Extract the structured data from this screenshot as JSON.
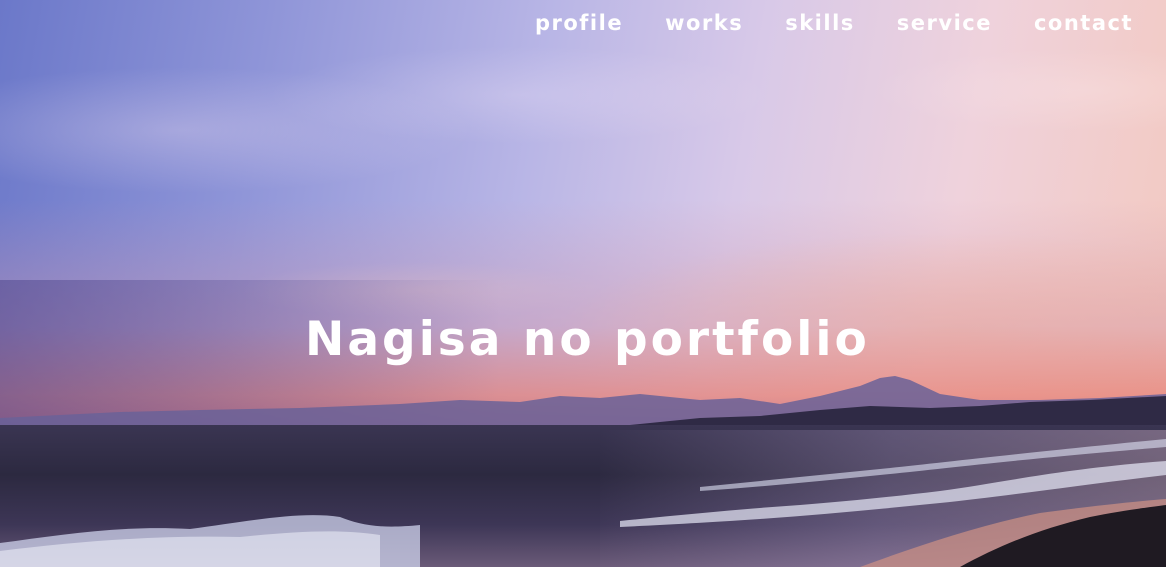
{
  "nav": {
    "items": [
      {
        "label": "profile"
      },
      {
        "label": "works"
      },
      {
        "label": "skills"
      },
      {
        "label": "service"
      },
      {
        "label": "contact"
      }
    ]
  },
  "hero": {
    "title": "Nagisa no portfolio"
  },
  "colors": {
    "text": "#ffffff",
    "sky_top_left": "#6b78c9",
    "sky_right": "#f3c9c0",
    "sea": "#2c2940"
  }
}
